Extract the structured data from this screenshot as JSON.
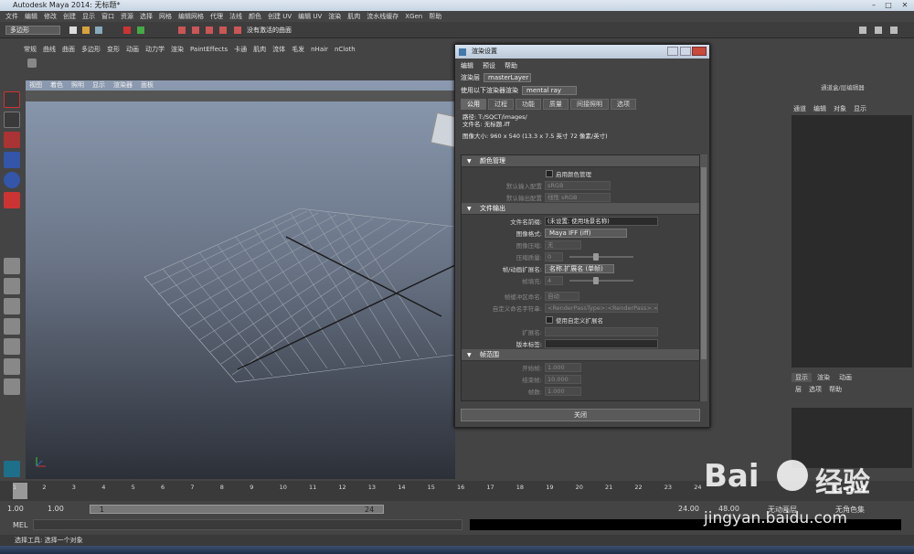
{
  "window": {
    "title": "Autodesk Maya 2014: 无标题*",
    "min": "–",
    "max": "□",
    "close": "✕"
  },
  "menubar": [
    "文件",
    "编辑",
    "修改",
    "创建",
    "显示",
    "窗口",
    "资源",
    "选择",
    "网格",
    "编辑网格",
    "代理",
    "法线",
    "颜色",
    "创建 UV",
    "编辑 UV",
    "渲染",
    "肌肉",
    "流水线缓存",
    "XGen",
    "帮助"
  ],
  "statusline": {
    "mode": "多边形",
    "live_surface": "没有激活的曲面"
  },
  "shelf_tabs": [
    "常规",
    "曲线",
    "曲面",
    "多边形",
    "变形",
    "动画",
    "动力学",
    "渲染",
    "PaintEffects",
    "卡通",
    "肌肉",
    "流体",
    "毛发",
    "nHair",
    "nCloth"
  ],
  "viewport": {
    "menu": [
      "视图",
      "着色",
      "照明",
      "显示",
      "渲染器",
      "面板"
    ]
  },
  "dialog": {
    "title": "渲染设置",
    "menu": [
      "编辑",
      "预设",
      "帮助"
    ],
    "layer_label": "渲染层",
    "layer_value": "masterLayer",
    "renderer_label": "使用以下渲染器渲染",
    "renderer_value": "mental ray",
    "tabs": [
      "公用",
      "过程",
      "功能",
      "质量",
      "间接照明",
      "选项"
    ],
    "path": "路径: T:/SQCT/images/",
    "filename": "文件名: 无标题.iff",
    "image_size": "图像大小: 960 x 540 (13.3 x 7.5 英寸 72 像素/英寸)",
    "color_mgmt": {
      "header": "颜色管理",
      "enable": "启用颜色管理",
      "input_label": "默认输入配置",
      "input_value": "sRGB",
      "output_label": "默认输出配置",
      "output_value": "线性 sRGB"
    },
    "file_output": {
      "header": "文件输出",
      "prefix_label": "文件名前缀:",
      "prefix_value": "(未设置; 使用场景名称)",
      "format_label": "图像格式:",
      "format_value": "Maya IFF (iff)",
      "compress_label": "图像压缩:",
      "compress_value": "无",
      "quality_label": "压缩质量:",
      "quality_value": "0",
      "ext_label": "帧/动画扩展名:",
      "ext_value": "名称.扩展名 (单帧)",
      "pad_label": "帧填充:",
      "pad_value": "4",
      "frame_label": "帧缓冲区命名:",
      "frame_value": "自动",
      "custom_label": "自定义命名字符串:",
      "custom_value": "<RenderPassType>:<RenderPass>.<Camera>",
      "use_custom": "使用自定义扩展名",
      "extname_label": "扩展名:",
      "version_label": "版本标签:"
    },
    "frame_range": {
      "header": "帧范围",
      "start_label": "开始帧:",
      "start_value": "1.000",
      "end_label": "结束帧:",
      "end_value": "10.000",
      "by_label": "帧数:",
      "by_value": "1.000"
    },
    "close": "关闭"
  },
  "right_panel": {
    "title": "通道盒/层编辑器",
    "menu": [
      "通道",
      "编辑",
      "对象",
      "显示"
    ],
    "tabs": [
      "显示",
      "渲染",
      "动画"
    ],
    "layer_menu": [
      "层",
      "选项",
      "帮助"
    ]
  },
  "timeline": {
    "ticks": [
      "1",
      "2",
      "3",
      "4",
      "5",
      "6",
      "7",
      "8",
      "9",
      "10",
      "11",
      "12",
      "13",
      "14",
      "15",
      "16",
      "17",
      "18",
      "19",
      "20",
      "21",
      "22",
      "23",
      "24"
    ],
    "current": "1"
  },
  "range": {
    "start": "1.00",
    "inner_start": "1.00",
    "marker_start": "1",
    "marker_end": "24",
    "inner_end": "24.00",
    "end": "48.00",
    "anim_layer": "无动画层",
    "char_set": "无角色集"
  },
  "cmd": {
    "label": "MEL"
  },
  "help": "选择工具: 选择一个对象",
  "watermark": {
    "brand": "Bai",
    "brand2": "经验",
    "url": "jingyan.baidu.com"
  }
}
